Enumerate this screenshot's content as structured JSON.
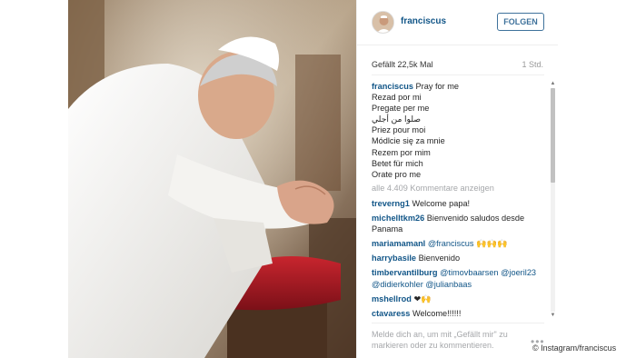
{
  "post": {
    "username": "franciscus",
    "follow_label": "FOLGEN",
    "likes": "Gefällt 22,5k Mal",
    "time": "1 Std."
  },
  "caption": {
    "user": "franciscus",
    "lines": [
      "Pray for me",
      "Rezad por mi",
      "Pregate per me",
      "صلوا من أجلي",
      "Priez pour moi",
      "Módlcie się za mnie",
      "Rezem por mim",
      "Betet für mich",
      "Orate pro me"
    ]
  },
  "view_all_comments": "alle 4.409 Kommentare anzeigen",
  "comments": [
    {
      "user": "treverng1",
      "text": "Welcome papa!"
    },
    {
      "user": "michelltkm26",
      "text": "Bienvenido saludos desde Panama"
    },
    {
      "user": "mariamamanl",
      "mention": "@franciscus",
      "text": "🙌🙌🙌"
    },
    {
      "user": "harrybasile",
      "text": "Bienvenido"
    },
    {
      "user": "timbervantilburg",
      "mention": "@timovbaarsen @joeril23 @didierkohler @julianbaas",
      "text": ""
    },
    {
      "user": "mshellrod",
      "text": "❤🙌"
    },
    {
      "user": "ctavaress",
      "text": "Welcome!!!!!!"
    }
  ],
  "footer": {
    "login_prompt": "Melde dich an, um mit „Gefällt mir\" zu markieren oder zu kommentieren.",
    "more": "•••"
  },
  "credit": "© Instagram/franciscus",
  "colors": {
    "link_blue": "#125688",
    "follow_blue": "#3f729b",
    "muted_gray": "#a5a7aa"
  }
}
